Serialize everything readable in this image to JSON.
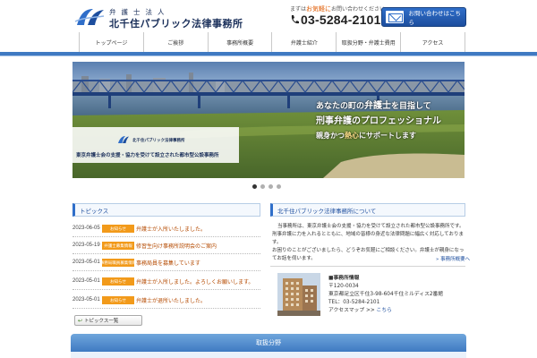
{
  "header": {
    "logo_small": "弁護士法人",
    "logo_name": "北千住パブリック法律事務所",
    "phone_caption_pre": "まずは",
    "phone_caption_em": "お気軽に",
    "phone_caption_post": "お問い合わせください",
    "phone_number": "03-5284-2101",
    "contact_label": "お問い合わせはこちら"
  },
  "nav": {
    "items": [
      {
        "label": "トップページ"
      },
      {
        "label": "ご挨拶"
      },
      {
        "label": "事務所概要"
      },
      {
        "label": "弁護士紹介"
      },
      {
        "label": "取扱分野・弁護士費用"
      },
      {
        "label": "アクセス"
      }
    ]
  },
  "hero": {
    "line1_pre": "あなたの町の",
    "line1_big": "弁護士",
    "line1_post": "を目指して",
    "line2": "刑事弁護のプロフェッショナル",
    "line3_pre": "親身かつ",
    "line3_hl": "熱心",
    "line3_post": "にサポートします",
    "card_logo": "北千住パブリック法律事務所",
    "card_text": "東京弁護士会の支援・協力を受けて設立された都市型公設事務所",
    "slide_count": 4,
    "active_slide": 1
  },
  "topics": {
    "heading": "トピックス",
    "items": [
      {
        "date": "2023-06-05",
        "tag": "お知らせ",
        "title": "弁護士が入所いたしました。"
      },
      {
        "date": "2023-05-19",
        "tag": "弁護士募集情報",
        "title": "修習生向け事務所説明会のご案内"
      },
      {
        "date": "2023-05-01",
        "tag": "事務局職員募集情報",
        "title": "事務局員を募集しています"
      },
      {
        "date": "2023-05-01",
        "tag": "お知らせ",
        "title": "弁護士が入所しました。よろしくお願いします。"
      },
      {
        "date": "2023-05-01",
        "tag": "お知らせ",
        "title": "弁護士が退所いたしました。"
      }
    ],
    "list_button": "トピックス一覧"
  },
  "about": {
    "heading": "北千住パブリック法律事務所について",
    "paragraph1": "当事務所は、東京弁護士会の支援・協力を受けて設立された都市型公設事務所です。刑事弁護に力を入れるとともに、地域の皆様の身近な法律問題に幅広く対応しております。",
    "paragraph2": "お困りのことがございましたら、どうぞお気軽にご相談ください。弁護士が親身になってお話を伺います。",
    "more_link": "» 事務所概要へ"
  },
  "office": {
    "title": "■事務所情報",
    "postal": "〒120-0034",
    "address": "東京都足立区千住3-98-604千住ミルディス2番館",
    "tel": "TEL：03-5284-2101",
    "map_label": "アクセスマップ >> ",
    "map_link": "こちら"
  },
  "bottom": {
    "label": "取扱分野"
  },
  "colors": {
    "accent": "#2f6ec9",
    "nav_line": "#3f7ac2",
    "tag": "#f29a1a",
    "topic_title": "#b54a00"
  }
}
